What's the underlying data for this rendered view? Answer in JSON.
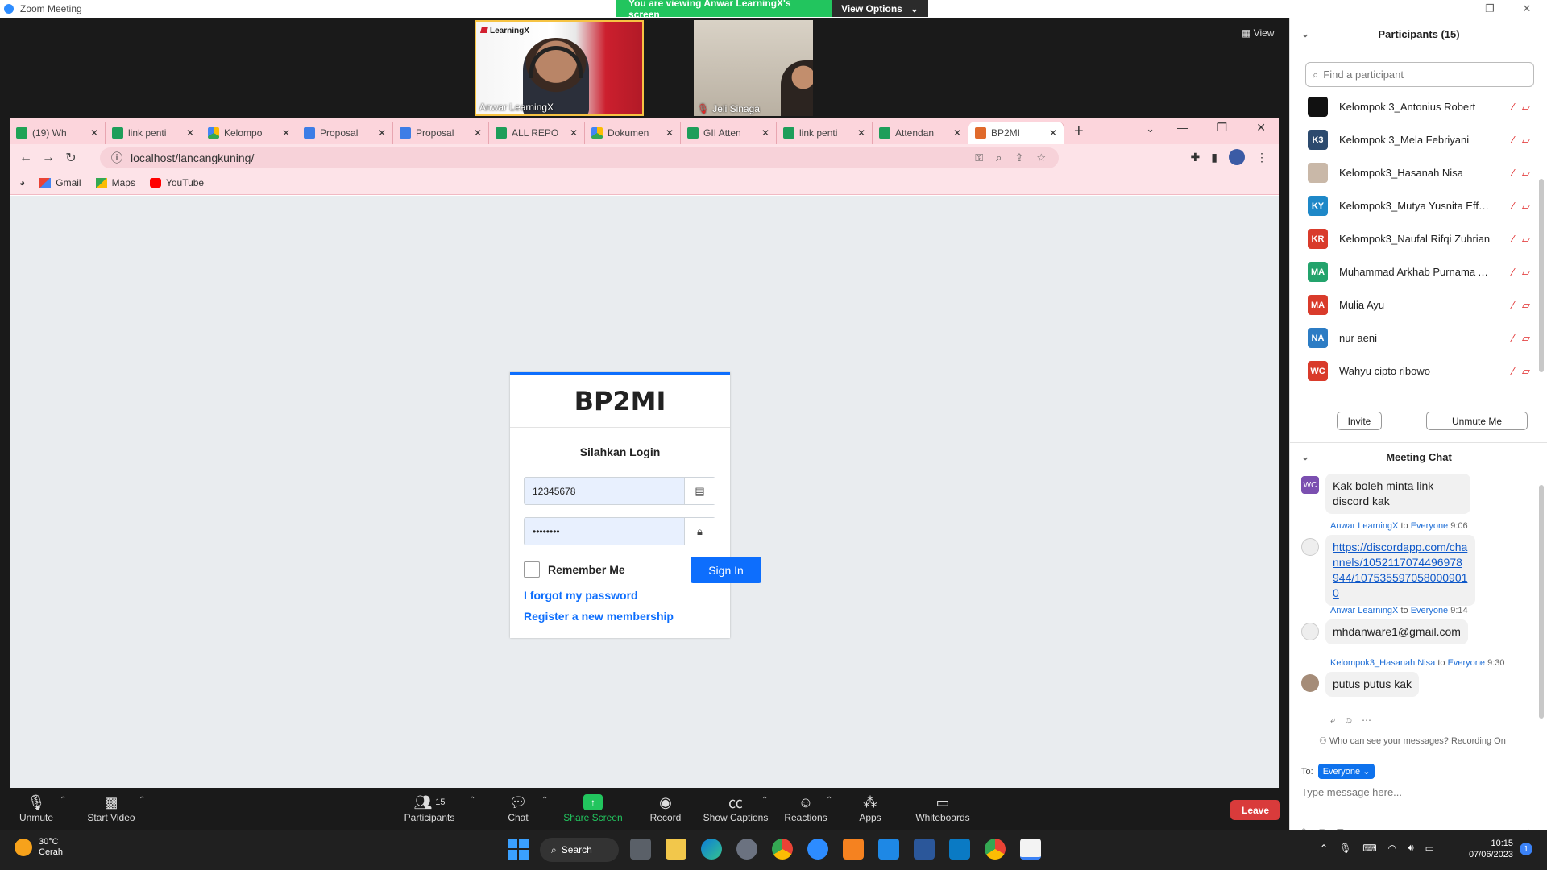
{
  "zoom": {
    "window_title": "Zoom Meeting",
    "banner_text": "You are viewing Anwar LearningX's screen",
    "view_options": "View Options",
    "view_label": "View",
    "video_tiles": [
      {
        "name": "Anwar LearningX",
        "brand": "LearningX"
      },
      {
        "name": "Jeli Sinaga"
      }
    ]
  },
  "browser": {
    "tabs": [
      {
        "label": "(19) Wh",
        "icon": "whatsapp"
      },
      {
        "label": "link penti",
        "icon": "sheets"
      },
      {
        "label": "Kelompo",
        "icon": "drive"
      },
      {
        "label": "Proposal",
        "icon": "docs"
      },
      {
        "label": "Proposal",
        "icon": "docs"
      },
      {
        "label": "ALL REPO",
        "icon": "sheets"
      },
      {
        "label": "Dokumen",
        "icon": "drive"
      },
      {
        "label": "GII Atten",
        "icon": "sheets"
      },
      {
        "label": "link penti",
        "icon": "sheets"
      },
      {
        "label": "Attendan",
        "icon": "sheets"
      },
      {
        "label": "BP2MI",
        "icon": "xampp",
        "active": true
      }
    ],
    "url": "localhost/lancangkuning/",
    "bookmarks": [
      "Gmail",
      "Maps",
      "YouTube"
    ]
  },
  "login": {
    "logo": "BP2MI",
    "message": "Silahkan Login",
    "username_value": "12345678",
    "password_value": "••••••••",
    "remember_label": "Remember Me",
    "signin_label": "Sign In",
    "forgot_link": "I forgot my password",
    "register_link": "Register a new membership"
  },
  "toolbar": {
    "unmute": "Unmute",
    "start_video": "Start Video",
    "participants": "Participants",
    "participants_count": "15",
    "chat": "Chat",
    "share_screen": "Share Screen",
    "record": "Record",
    "show_captions": "Show Captions",
    "reactions": "Reactions",
    "apps": "Apps",
    "whiteboards": "Whiteboards",
    "leave": "Leave"
  },
  "participants_panel": {
    "title": "Participants (15)",
    "search_placeholder": "Find a participant",
    "participants": [
      {
        "name": "Kelompok 3_Antonius Robert",
        "initials": "",
        "color": "#111111"
      },
      {
        "name": "Kelompok 3_Mela Febriyani",
        "initials": "K3",
        "color": "#2c4a6e"
      },
      {
        "name": "Kelompok3_Hasanah Nisa",
        "initials": "",
        "color": "#c9b8a8"
      },
      {
        "name": "Kelompok3_Mutya Yusnita Effe...",
        "initials": "KY",
        "color": "#1e88c8"
      },
      {
        "name": "Kelompok3_Naufal Rifqi Zuhrian",
        "initials": "KR",
        "color": "#d93b2b"
      },
      {
        "name": "Muhammad Arkhab Purnama A...",
        "initials": "MA",
        "color": "#23a36c"
      },
      {
        "name": "Mulia Ayu",
        "initials": "MA",
        "color": "#d93b2b"
      },
      {
        "name": "nur aeni",
        "initials": "NA",
        "color": "#2c7cc4"
      },
      {
        "name": "Wahyu cipto ribowo",
        "initials": "WC",
        "color": "#d93b2b"
      }
    ],
    "invite": "Invite",
    "unmute_me": "Unmute Me"
  },
  "chat": {
    "title": "Meeting Chat",
    "messages": [
      {
        "avatar": "WC",
        "text": "Kak boleh minta link discord kak"
      },
      {
        "sender": "Anwar LearningX",
        "to_label": "to",
        "to": "Everyone",
        "time": "9:06",
        "text": "https://discordapp.com/channels/1052117074496978944/1075355970580009010"
      },
      {
        "sender": "Anwar LearningX",
        "to_label": "to",
        "to": "Everyone",
        "time": "9:14",
        "text": "mhdanware1@gmail.com"
      },
      {
        "sender": "Kelompok3_Hasanah Nisa",
        "to_label": "to",
        "to": "Everyone",
        "time": "9:30",
        "text": "putus putus kak"
      }
    ],
    "who_can_see": "Who can see your messages? Recording On",
    "to_label": "To:",
    "to_value": "Everyone",
    "input_placeholder": "Type message here..."
  },
  "taskbar": {
    "temperature": "30°C",
    "weather": "Cerah",
    "search": "Search",
    "time": "10:15",
    "date": "07/06/2023",
    "notification_count": "1"
  }
}
